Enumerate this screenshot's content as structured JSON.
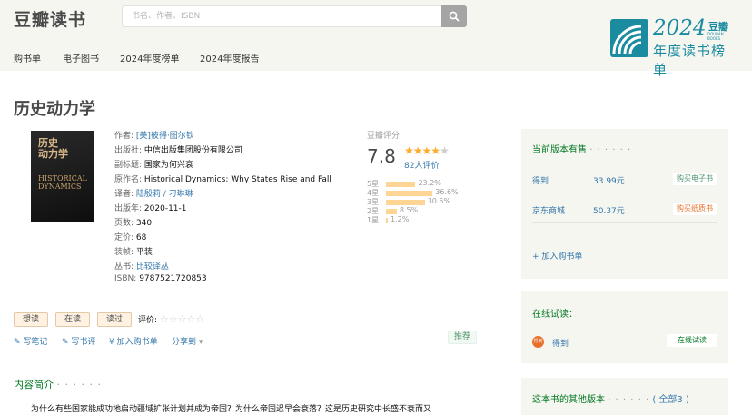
{
  "header": {
    "logo": "豆瓣读书",
    "search_placeholder": "书名、作者、ISBN",
    "nav": [
      "购书单",
      "电子图书",
      "2024年度榜单",
      "2024年度报告"
    ],
    "badge": {
      "year": "2024",
      "brand": "豆瓣",
      "sub": "DOUBAN BOOKS",
      "title": "年度读书榜单"
    }
  },
  "book": {
    "title": "历史动力学",
    "cover": {
      "cn": "历史\n动力学",
      "subtitle": "国家为何兴衰",
      "en": "HISTORICAL\nDYNAMICS"
    },
    "info": [
      {
        "label": "作者:",
        "value": "[美]彼得·图尔钦",
        "link": true
      },
      {
        "label": "出版社:",
        "value": "中信出版集团股份有限公司",
        "link": false
      },
      {
        "label": "副标题:",
        "value": "国家为何兴衰",
        "link": false
      },
      {
        "label": "原作名:",
        "value": "Historical Dynamics: Why States Rise and Fall",
        "link": false
      },
      {
        "label": "译者:",
        "value": "陆殷莉 / 刁琳琳",
        "link": true
      },
      {
        "label": "出版年:",
        "value": "2020-11-1",
        "link": false
      },
      {
        "label": "页数:",
        "value": "340",
        "link": false
      },
      {
        "label": "定价:",
        "value": "68",
        "link": false
      },
      {
        "label": "装帧:",
        "value": "平装",
        "link": false
      },
      {
        "label": "丛书:",
        "value": "比较译丛",
        "link": true
      },
      {
        "label": "ISBN:",
        "value": "9787521720853",
        "link": false
      }
    ]
  },
  "rating": {
    "label": "豆瓣评分",
    "score": "7.8",
    "stars_on": 4,
    "stars_total": 5,
    "votes": "82人评价",
    "distribution": [
      {
        "star": "5星",
        "percent": 23.2,
        "text": "23.2%"
      },
      {
        "star": "4星",
        "percent": 36.6,
        "text": "36.6%"
      },
      {
        "star": "3星",
        "percent": 30.5,
        "text": "30.5%"
      },
      {
        "star": "2星",
        "percent": 8.5,
        "text": "8.5%"
      },
      {
        "star": "1星",
        "percent": 1.2,
        "text": "1.2%"
      }
    ]
  },
  "actions": {
    "want": "想读",
    "reading": "在读",
    "read": "读过",
    "rate_label": "评价:",
    "rate_stars": "☆☆☆☆☆",
    "links": [
      "写笔记",
      "写书评",
      "加入购书单",
      "分享到"
    ],
    "recommend": "推荐"
  },
  "intro": {
    "heading": "内容简介",
    "dots": "· · · · · ·",
    "text": "为什么有些国家能成功地启动疆域扩张计划并成为帝国？为什么帝国迟早会衰落？这是历史研究中长盛不衰而又"
  },
  "sidebar": {
    "editions_heading": "当前版本有售",
    "dots": "· · · · · ·",
    "editions": [
      {
        "name": "得到",
        "price": "33.99元",
        "button": "购买电子书",
        "color": "#4f946e"
      },
      {
        "name": "京东商城",
        "price": "50.37元",
        "button": "购买纸质书",
        "color": "#e8702a"
      }
    ],
    "add_cart": "+ 加入购书单",
    "trial_heading": "在线试读：",
    "trial_icon": "得到",
    "trial_name": "得到",
    "trial_button": "在线试读",
    "other_heading": "这本书的其他版本",
    "other_all": "( 全部3 )"
  }
}
